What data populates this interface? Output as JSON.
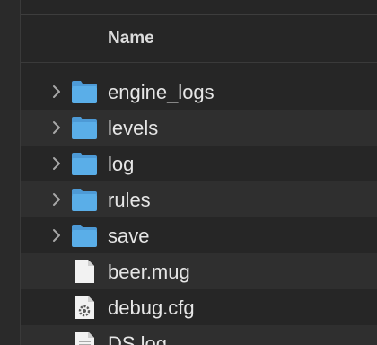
{
  "list": {
    "column_header": "Name",
    "items": [
      {
        "name": "engine_logs",
        "kind": "folder",
        "icon": "folder-icon"
      },
      {
        "name": "levels",
        "kind": "folder",
        "icon": "folder-icon"
      },
      {
        "name": "log",
        "kind": "folder",
        "icon": "folder-icon"
      },
      {
        "name": "rules",
        "kind": "folder",
        "icon": "folder-icon"
      },
      {
        "name": "save",
        "kind": "folder",
        "icon": "folder-icon"
      },
      {
        "name": "beer.mug",
        "kind": "file",
        "icon": "document-icon"
      },
      {
        "name": "debug.cfg",
        "kind": "config",
        "icon": "config-file-icon"
      },
      {
        "name": "DS.log",
        "kind": "log",
        "icon": "log-file-icon"
      }
    ]
  },
  "colors": {
    "folder": "#5aaee8",
    "folder_tab": "#4d9ad6",
    "row_alt": "#2f2f2f",
    "background": "#262626"
  }
}
